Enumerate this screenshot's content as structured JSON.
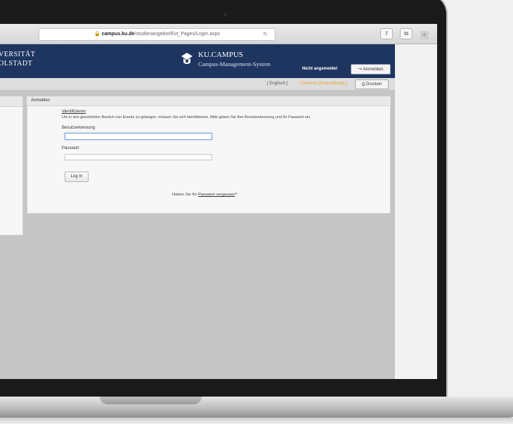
{
  "browser": {
    "url_host": "campus.ku.de",
    "url_path": "/studienangebot/Evt_Pages/Login.aspx",
    "lock_glyph": "🔒",
    "reload_glyph": "↻",
    "share_glyph": "⇧",
    "tabs_glyph": "⧉",
    "newtab_glyph": "+"
  },
  "header": {
    "university_line1": "VERSITÄT",
    "university_line2": "OLSTADT",
    "brand_title": "KU.CAMPUS",
    "brand_subtitle": "Campus-Management-System",
    "login_status": "Nicht angemeldet",
    "login_button": "Anmelden",
    "login_icon": "↪"
  },
  "topbar": {
    "lang_en": "[ Englisch ]",
    "lang_de": "[ Deutsch (Deutschland) ]",
    "lang_end": "]",
    "print_button": "Drucken",
    "print_icon": "⎙"
  },
  "login_panel": {
    "panel_title": "Anmelden",
    "section_title": "Identifizieren",
    "section_description": "Um in den geschützten Bereich von Evento zu gelangen, müssen Sie sich identifizieren. Bitte geben Sie Ihre Benutzerkennung und Ihr Passwort ein.",
    "username_label": "Benutzerkennung",
    "username_value": "",
    "password_label": "Passwort",
    "password_value": "",
    "submit_button": "Log In",
    "forgot_prefix": "Haben Sie Ihr ",
    "forgot_link": "Passwort vergessen",
    "forgot_suffix": "?"
  },
  "colors": {
    "header_bg": "#1e3560",
    "language_active": "#e8a12a"
  }
}
